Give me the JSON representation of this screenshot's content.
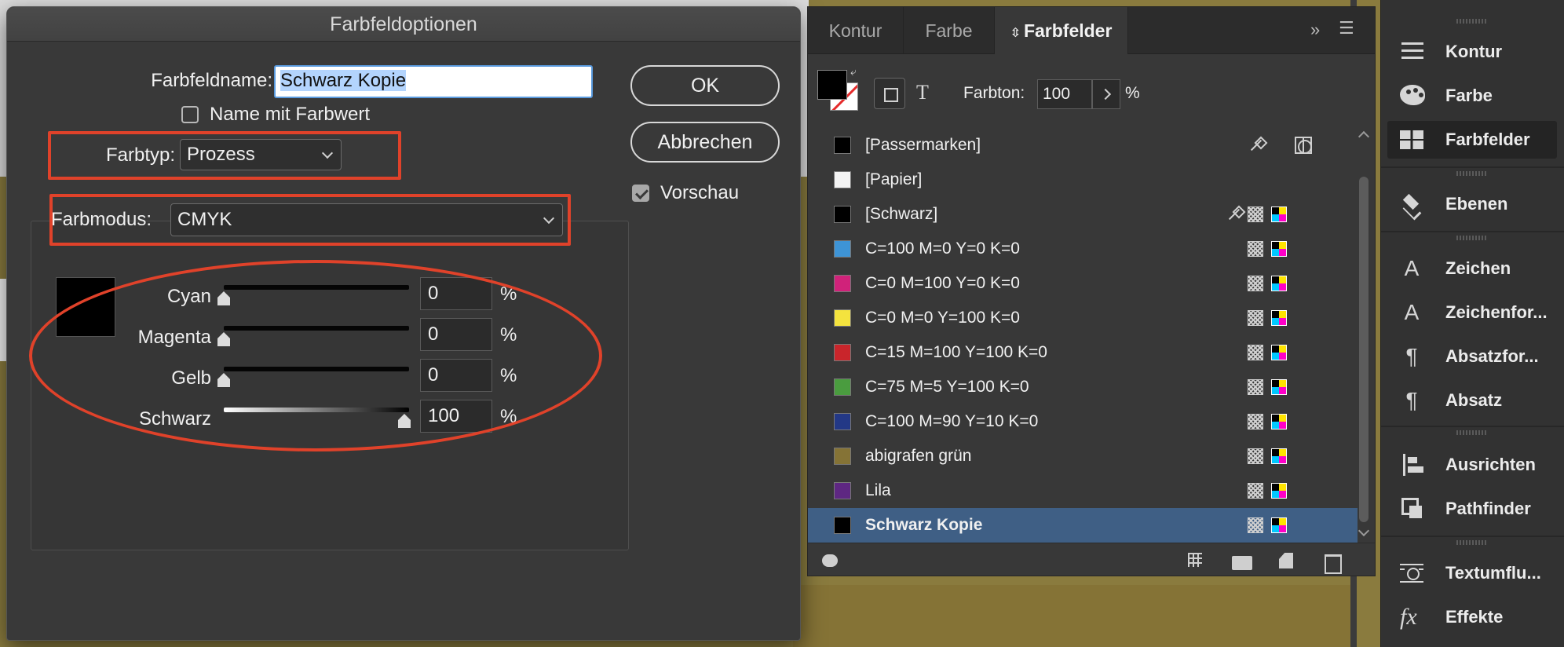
{
  "dialog": {
    "title": "Farbfeldoptionen",
    "swatch_name_label": "Farbfeldname:",
    "swatch_name_value": "Schwarz Kopie",
    "name_with_value_label": "Name mit Farbwert",
    "name_with_value_checked": false,
    "color_type_label": "Farbtyp:",
    "color_type_value": "Prozess",
    "color_mode_label": "Farbmodus:",
    "color_mode_value": "CMYK",
    "ok_label": "OK",
    "cancel_label": "Abbrechen",
    "preview_label": "Vorschau",
    "preview_checked": true,
    "highlight_color": "#e0422a",
    "channels": [
      {
        "label": "Cyan",
        "value": "0",
        "unit": "%"
      },
      {
        "label": "Magenta",
        "value": "0",
        "unit": "%"
      },
      {
        "label": "Gelb",
        "value": "0",
        "unit": "%"
      },
      {
        "label": "Schwarz",
        "value": "100",
        "unit": "%"
      }
    ]
  },
  "panel": {
    "tabs": [
      {
        "label": "Kontur",
        "active": false
      },
      {
        "label": "Farbe",
        "active": false
      },
      {
        "label": "Farbfelder",
        "active": true
      }
    ],
    "tint_label": "Farbton:",
    "tint_value": "100",
    "tint_unit": "%",
    "swatches": [
      {
        "name": "[Passermarken]",
        "color": "#000000",
        "icons": [
          "nonedit-icon",
          "registration-icon"
        ]
      },
      {
        "name": "[Papier]",
        "color": "#f4f4f4",
        "icons": []
      },
      {
        "name": "[Schwarz]",
        "color": "#000000",
        "icons": [
          "nonedit-icon",
          "process-icon",
          "cmyk-icon"
        ]
      },
      {
        "name": "C=100 M=0 Y=0 K=0",
        "color": "#3e94d6",
        "icons": [
          "process-icon",
          "cmyk-icon"
        ]
      },
      {
        "name": "C=0 M=100 Y=0 K=0",
        "color": "#d0227a",
        "icons": [
          "process-icon",
          "cmyk-icon"
        ]
      },
      {
        "name": "C=0 M=0 Y=100 K=0",
        "color": "#f4e33e",
        "icons": [
          "process-icon",
          "cmyk-icon"
        ]
      },
      {
        "name": "C=15 M=100 Y=100 K=0",
        "color": "#c9252b",
        "icons": [
          "process-icon",
          "cmyk-icon"
        ]
      },
      {
        "name": "C=75 M=5 Y=100 K=0",
        "color": "#4a9c3f",
        "icons": [
          "process-icon",
          "cmyk-icon"
        ]
      },
      {
        "name": "C=100 M=90 Y=10 K=0",
        "color": "#233886",
        "icons": [
          "process-icon",
          "cmyk-icon"
        ]
      },
      {
        "name": "abigrafen grün",
        "color": "#857336",
        "icons": [
          "process-icon",
          "cmyk-icon"
        ]
      },
      {
        "name": "Lila",
        "color": "#5e2782",
        "icons": [
          "process-icon",
          "cmyk-icon"
        ]
      },
      {
        "name": "Schwarz Kopie",
        "color": "#000000",
        "icons": [
          "process-icon",
          "cmyk-icon"
        ],
        "selected": true
      }
    ]
  },
  "dock": {
    "items": [
      {
        "label": "Kontur",
        "icon": "stroke-lines-icon",
        "active": false
      },
      {
        "label": "Farbe",
        "icon": "palette-icon",
        "active": false
      },
      {
        "label": "Farbfelder",
        "icon": "swatches-grid-icon",
        "active": true
      },
      {
        "label": "Ebenen",
        "icon": "layers-icon",
        "active": false
      },
      {
        "label": "Zeichen",
        "icon": "character-icon",
        "active": false
      },
      {
        "label": "Zeichenfor...",
        "icon": "character-styles-icon",
        "active": false
      },
      {
        "label": "Absatzfor...",
        "icon": "paragraph-styles-icon",
        "active": false
      },
      {
        "label": "Absatz",
        "icon": "paragraph-icon",
        "active": false
      },
      {
        "label": "Ausrichten",
        "icon": "align-icon",
        "active": false
      },
      {
        "label": "Pathfinder",
        "icon": "pathfinder-icon",
        "active": false
      },
      {
        "label": "Textumflu...",
        "icon": "text-wrap-icon",
        "active": false
      },
      {
        "label": "Effekte",
        "icon": "fx-icon",
        "active": false
      }
    ]
  }
}
